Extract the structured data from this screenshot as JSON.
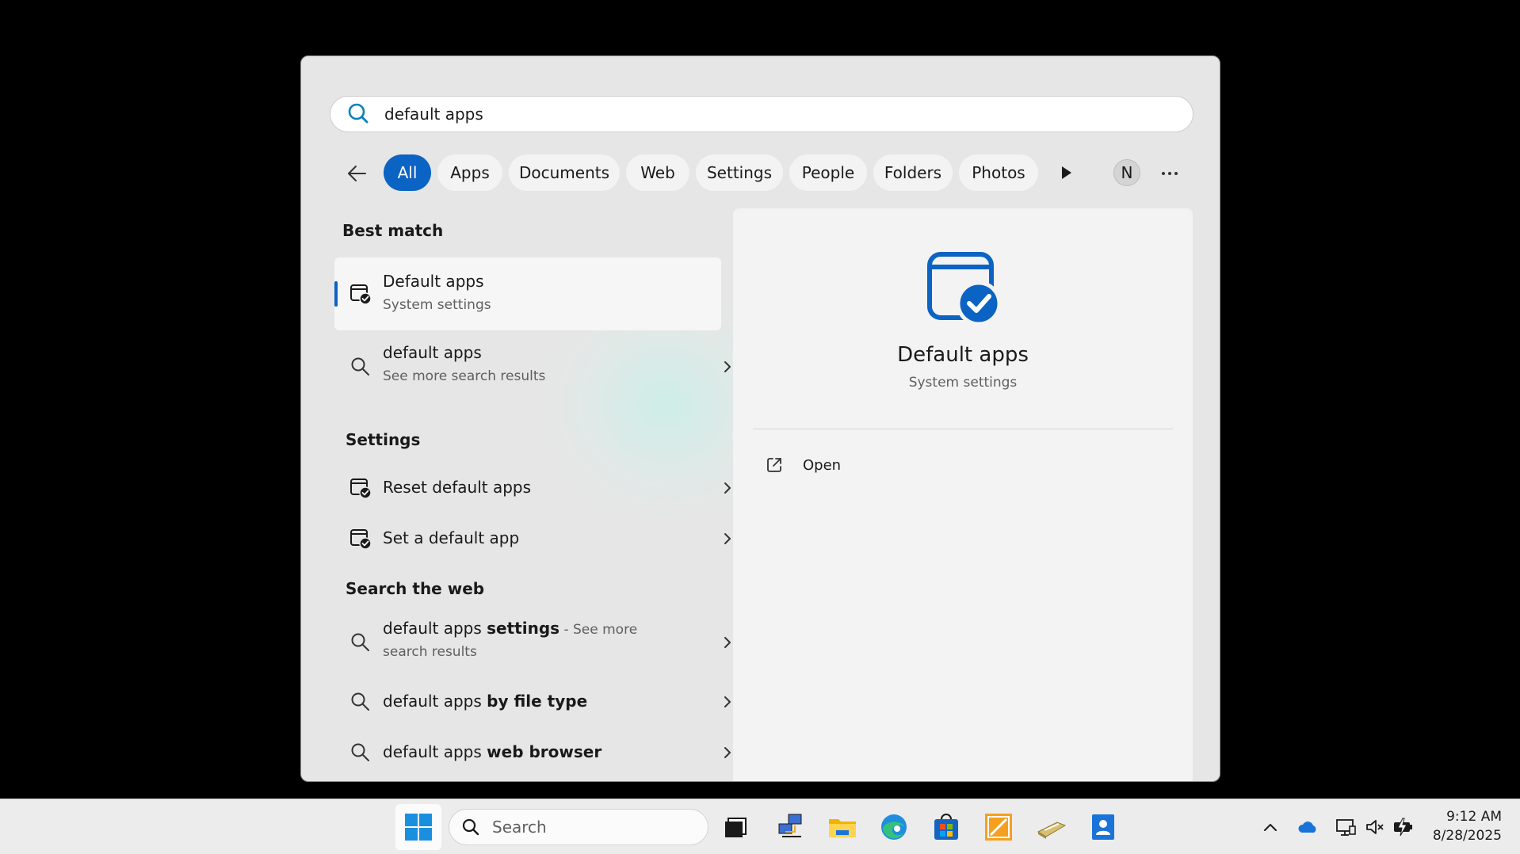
{
  "search": {
    "query": "default apps"
  },
  "filters": {
    "chips": [
      {
        "label": "All",
        "active": true
      },
      {
        "label": "Apps"
      },
      {
        "label": "Documents"
      },
      {
        "label": "Web"
      },
      {
        "label": "Settings"
      },
      {
        "label": "People"
      },
      {
        "label": "Folders"
      },
      {
        "label": "Photos"
      }
    ],
    "avatar_initial": "N"
  },
  "results": {
    "best_match_title": "Best match",
    "best": {
      "title": "Default apps",
      "subtitle": "System settings"
    },
    "more": {
      "title": "default apps",
      "subtitle": "See more search results"
    },
    "settings_title": "Settings",
    "settings_items": [
      "Reset default apps",
      "Set a default app"
    ],
    "web_title": "Search the web",
    "web_items": [
      {
        "prefix": "default apps ",
        "bold": "settings",
        "suffix": " - See more",
        "line2": "search results"
      },
      {
        "prefix": "default apps ",
        "bold": "by file type"
      },
      {
        "prefix": "default apps ",
        "bold": "web browser"
      }
    ]
  },
  "detail": {
    "title": "Default apps",
    "subtitle": "System settings",
    "open_label": "Open"
  },
  "taskbar": {
    "search_label": "Search",
    "time": "9:12 AM",
    "date": "8/28/2025"
  },
  "colors": {
    "accent": "#0b63c4",
    "panel": "#e6e6e6"
  }
}
